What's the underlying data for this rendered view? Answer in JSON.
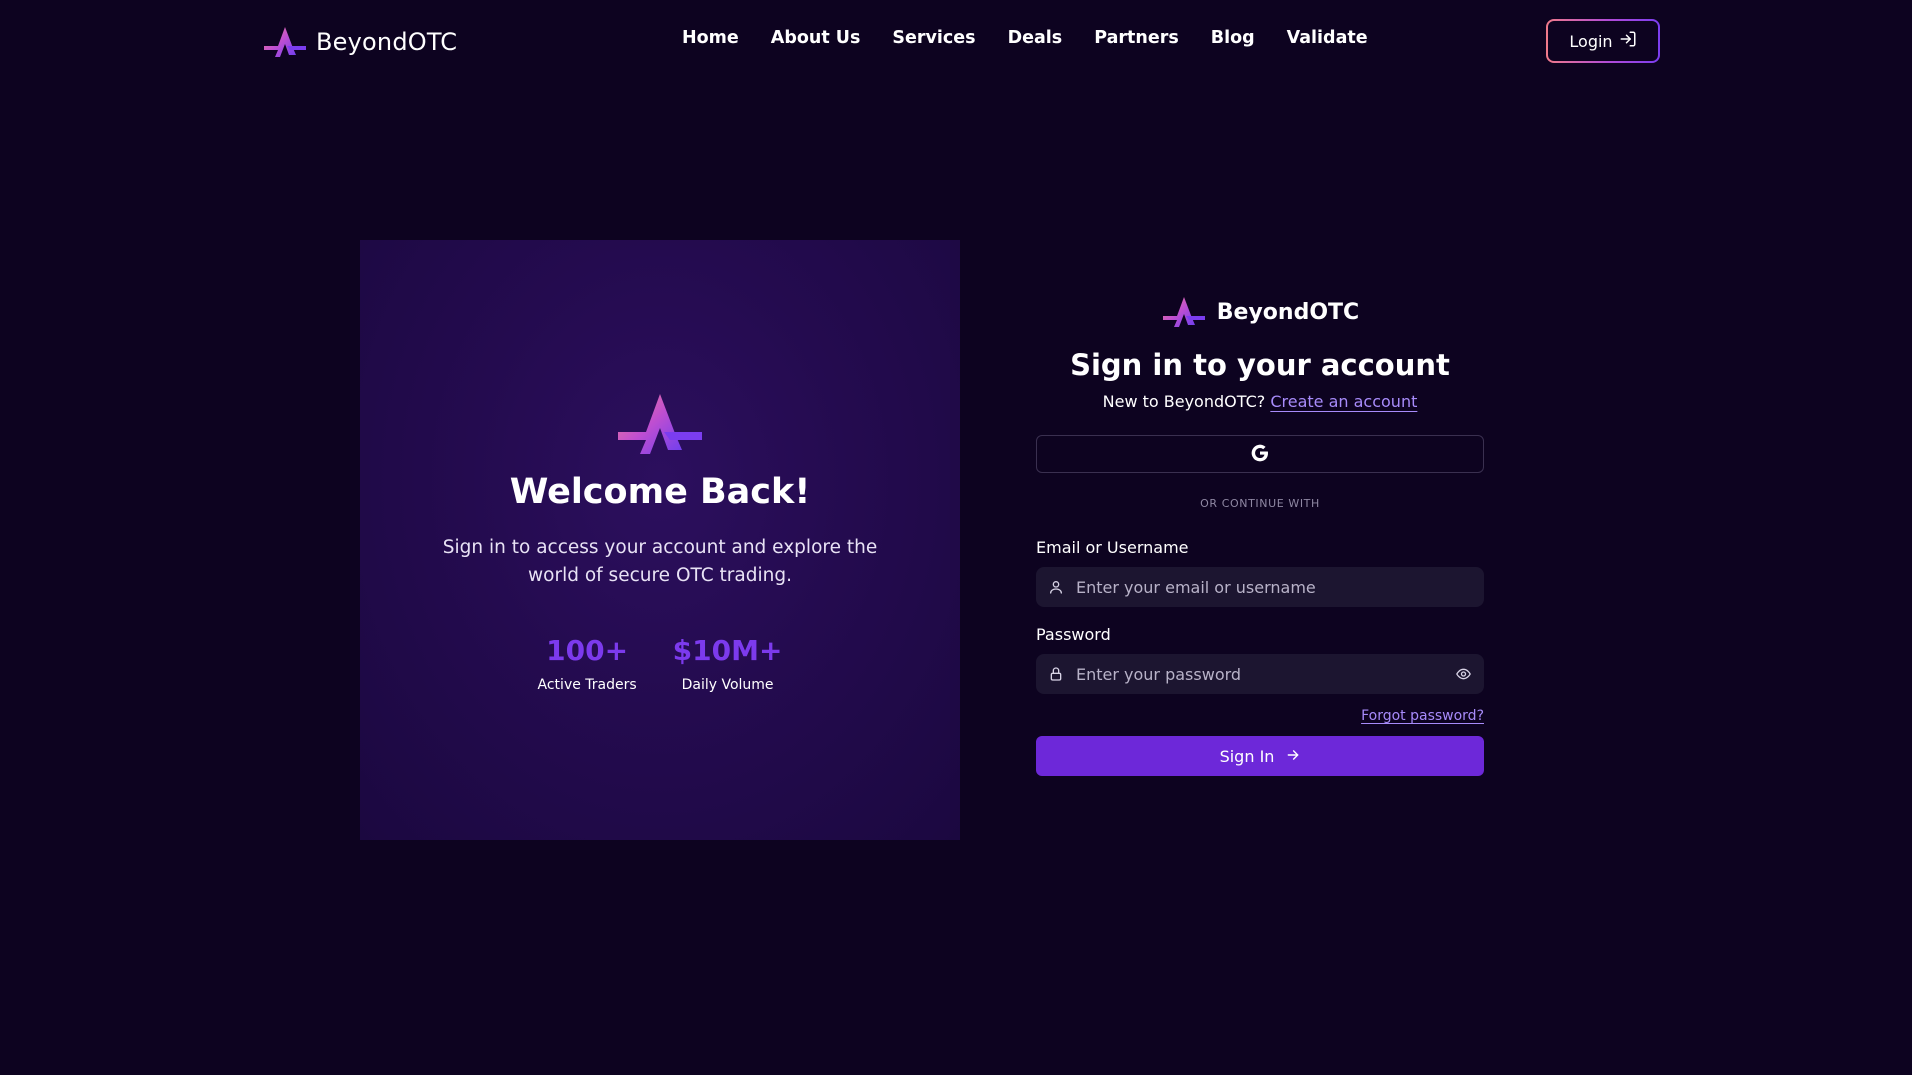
{
  "brand": {
    "name": "BeyondOTC"
  },
  "nav": {
    "links": [
      {
        "label": "Home"
      },
      {
        "label": "About Us"
      },
      {
        "label": "Services"
      },
      {
        "label": "Deals"
      },
      {
        "label": "Partners"
      },
      {
        "label": "Blog"
      },
      {
        "label": "Validate"
      }
    ],
    "login_label": "Login"
  },
  "welcome": {
    "title": "Welcome Back!",
    "subtitle": "Sign in to access your account and explore the world of secure OTC trading.",
    "stats": [
      {
        "value": "100+",
        "label": "Active Traders"
      },
      {
        "value": "$10M+",
        "label": "Daily Volume"
      }
    ]
  },
  "form": {
    "brand_name": "BeyondOTC",
    "title": "Sign in to your account",
    "new_prompt": "New to BeyondOTC?",
    "create_account_label": "Create an account",
    "google_icon": "google-icon",
    "divider": "OR CONTINUE WITH",
    "email": {
      "label": "Email or Username",
      "placeholder": "Enter your email or username",
      "value": ""
    },
    "password": {
      "label": "Password",
      "placeholder": "Enter your password",
      "value": ""
    },
    "forgot_label": "Forgot password?",
    "submit_label": "Sign In"
  },
  "colors": {
    "background": "#0d0320",
    "accent": "#6d28d9",
    "link": "#a78bfa",
    "stat_value": "#7c3aed"
  }
}
